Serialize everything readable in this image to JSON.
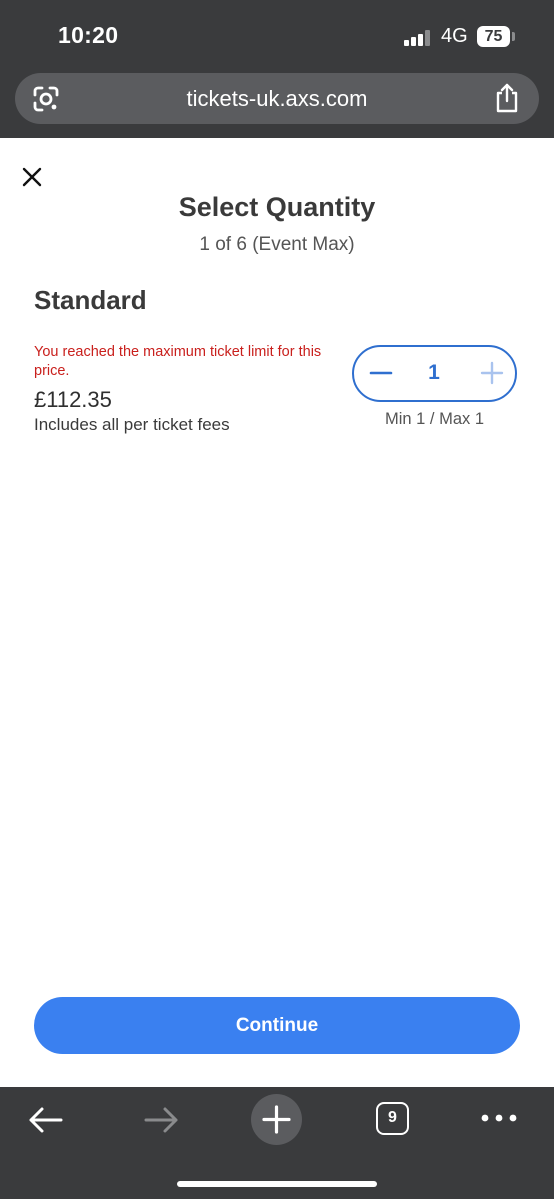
{
  "status_bar": {
    "time": "10:20",
    "network": "4G",
    "battery": "75"
  },
  "browser": {
    "url": "tickets-uk.axs.com",
    "tab_count": "9",
    "icons": {
      "lens": "google-lens-icon",
      "share": "share-icon",
      "back": "back-arrow-icon",
      "forward": "forward-arrow-icon",
      "new_tab": "plus-icon",
      "more": "more-dots-icon"
    }
  },
  "page": {
    "title": "Select Quantity",
    "subtitle": "1 of 6 (Event Max)",
    "ticket": {
      "name": "Standard",
      "warning": "You reached the maximum ticket limit for this price.",
      "price": "£112.35",
      "fees_note": "Includes all per ticket fees",
      "quantity": "1",
      "limits": "Min 1 / Max 1"
    },
    "continue_label": "Continue"
  },
  "colors": {
    "accent": "#3a80f0",
    "stepper": "#2f6fcf",
    "warning": "#c9201d",
    "chrome": "#3a3b3d"
  }
}
